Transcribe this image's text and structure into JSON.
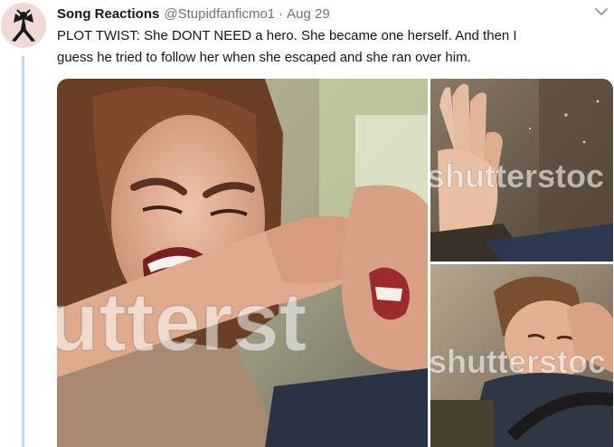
{
  "tweet": {
    "display_name": "Song Reactions",
    "handle": "@Stupidfanficmo1",
    "separator": "·",
    "date": "Aug 29",
    "text_line1": "PLOT TWIST: She DONT NEED a hero. She became one herself. And then I",
    "text_line2": "guess he tried to follow her when she escaped and she ran over him."
  },
  "media": {
    "main_watermark": "utterst",
    "top_right_watermark": "shutterstoc",
    "bottom_right_watermark": "shutterstoc"
  },
  "icons": {
    "avatar": "ribbon-silhouette-icon",
    "menu": "chevron-down-icon"
  },
  "colors": {
    "thread_line": "#c4d7ea",
    "muted_text": "#657786",
    "primary_text": "#14171a"
  }
}
